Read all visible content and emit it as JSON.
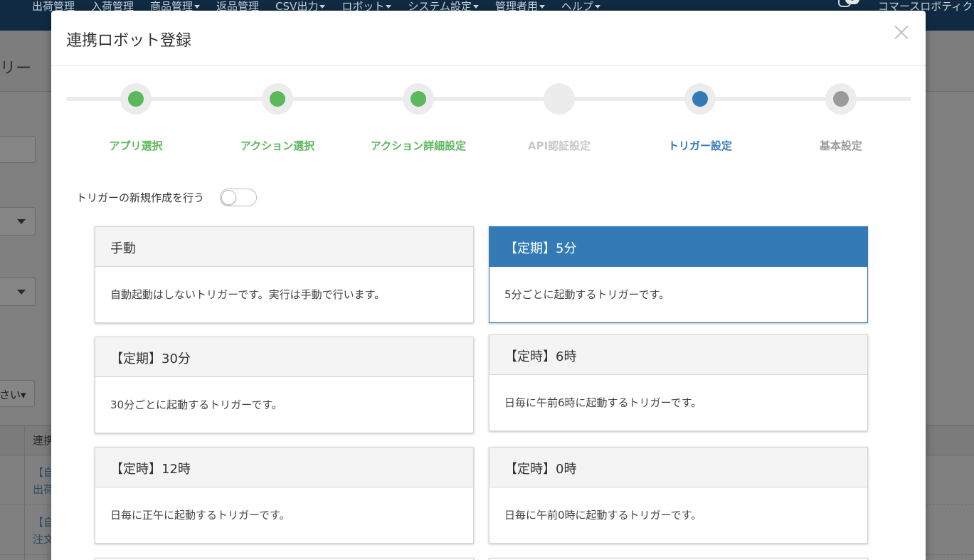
{
  "navbar": {
    "items": [
      {
        "label": "出荷管理",
        "dropdown": false
      },
      {
        "label": "入荷管理",
        "dropdown": false
      },
      {
        "label": "商品管理",
        "dropdown": true
      },
      {
        "label": "返品管理",
        "dropdown": false
      },
      {
        "label": "CSV出力",
        "dropdown": true
      },
      {
        "label": "ロボット",
        "dropdown": true
      },
      {
        "label": "システム設定",
        "dropdown": true
      },
      {
        "label": "管理者用",
        "dropdown": true
      },
      {
        "label": "ヘルプ",
        "dropdown": true
      }
    ],
    "notification_count": "0",
    "user_label": "コマースロボティクス"
  },
  "background": {
    "page_title": "リー",
    "button_label": "さい▾",
    "table_header": "連携",
    "rows": [
      {
        "line1": "【自",
        "line2": "出荷"
      },
      {
        "line1": "【自",
        "line2": "注文"
      }
    ]
  },
  "modal": {
    "title": "連携ロボット登録",
    "steps": [
      {
        "label": "アプリ選択",
        "state": "done"
      },
      {
        "label": "アクション選択",
        "state": "done"
      },
      {
        "label": "アクション詳細設定",
        "state": "done"
      },
      {
        "label": "API認証設定",
        "state": "skipped"
      },
      {
        "label": "トリガー設定",
        "state": "active"
      },
      {
        "label": "基本設定",
        "state": "pending"
      }
    ],
    "toggle_label": "トリガーの新規作成を行う",
    "toggle_on": false,
    "triggers": [
      {
        "title": "手動",
        "description": "自動起動はしないトリガーです。実行は手動で行います。",
        "selected": false
      },
      {
        "title": "【定期】5分",
        "description": "5分ごとに起動するトリガーです。",
        "selected": true
      },
      {
        "title": "【定期】30分",
        "description": "30分ごとに起動するトリガーです。",
        "selected": false
      },
      {
        "title": "【定時】6時",
        "description": "日毎に午前6時に起動するトリガーです。",
        "selected": false
      },
      {
        "title": "【定時】12時",
        "description": "日毎に正午に起動するトリガーです。",
        "selected": false
      },
      {
        "title": "【定時】0時",
        "description": "日毎に午前0時に起動するトリガーです。",
        "selected": false
      }
    ]
  },
  "colors": {
    "done": "#5cb85c",
    "active": "#337ab7",
    "pending": "#9a9a9a",
    "skipped": "#c8c8c8",
    "navbar": "#102a43"
  }
}
